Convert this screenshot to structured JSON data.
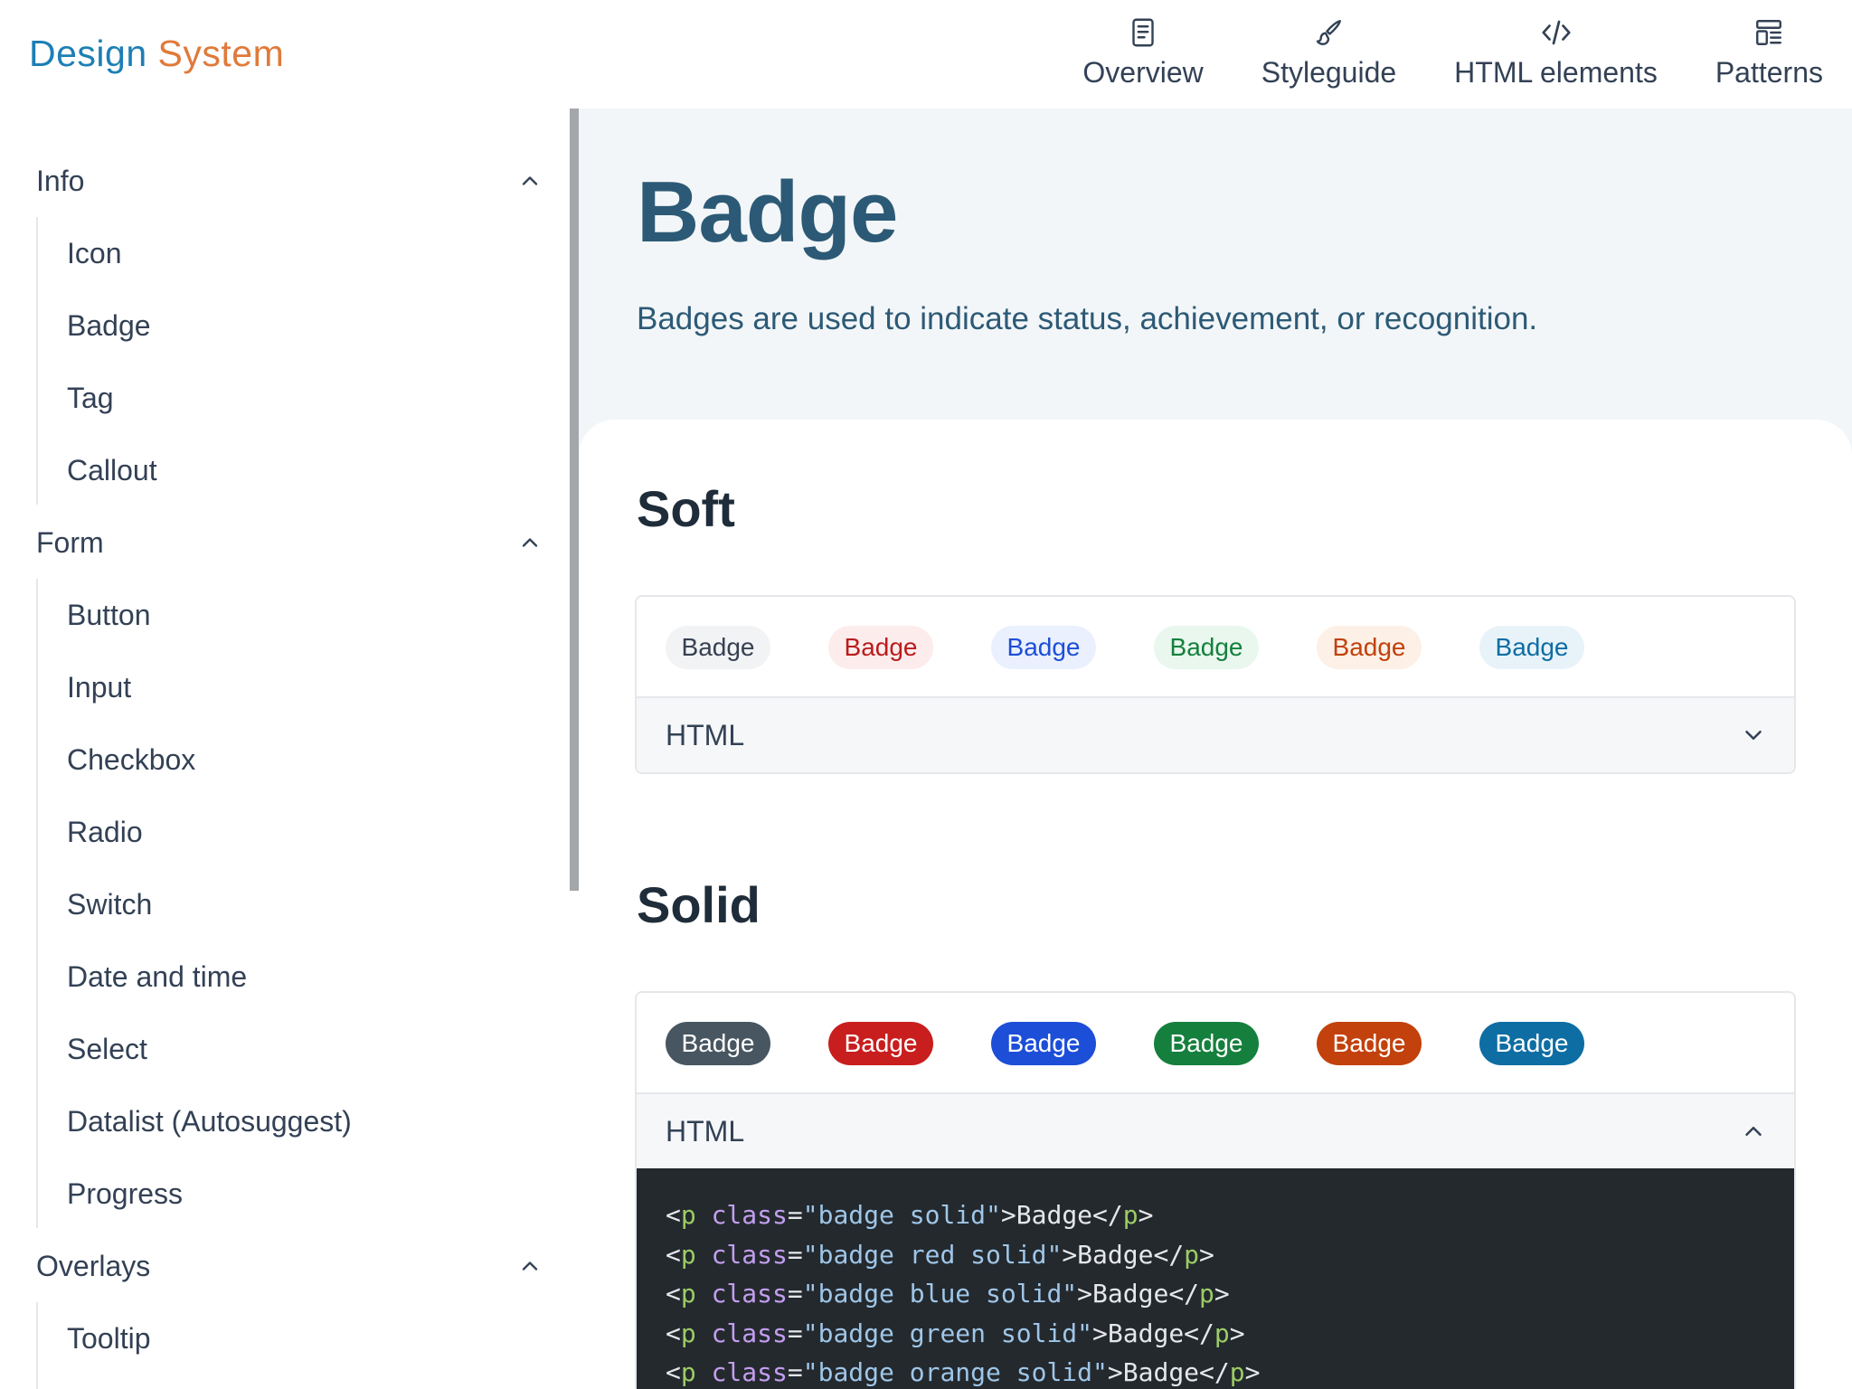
{
  "logo": {
    "word1": "Design",
    "word2": "System"
  },
  "topnav": [
    {
      "label": "Overview",
      "icon": "document-icon"
    },
    {
      "label": "Styleguide",
      "icon": "brush-icon"
    },
    {
      "label": "HTML elements",
      "icon": "code-icon"
    },
    {
      "label": "Patterns",
      "icon": "layout-icon"
    }
  ],
  "sidebar": {
    "groups": [
      {
        "label": "Info",
        "items": [
          "Icon",
          "Badge",
          "Tag",
          "Callout"
        ]
      },
      {
        "label": "Form",
        "items": [
          "Button",
          "Input",
          "Checkbox",
          "Radio",
          "Switch",
          "Date and time",
          "Select",
          "Datalist (Autosuggest)",
          "Progress"
        ]
      },
      {
        "label": "Overlays",
        "items": [
          "Tooltip"
        ]
      }
    ]
  },
  "page": {
    "title": "Badge",
    "description": "Badges are used to indicate status, achievement, or recognition."
  },
  "sections": {
    "soft": {
      "title": "Soft",
      "accordion_label": "HTML",
      "badges": [
        "Badge",
        "Badge",
        "Badge",
        "Badge",
        "Badge",
        "Badge"
      ]
    },
    "solid": {
      "title": "Solid",
      "accordion_label": "HTML",
      "badges": [
        "Badge",
        "Badge",
        "Badge",
        "Badge",
        "Badge",
        "Badge"
      ],
      "code_lines": [
        {
          "tag": "p",
          "attr": "class",
          "value": "\"badge solid\"",
          "text": "Badge"
        },
        {
          "tag": "p",
          "attr": "class",
          "value": "\"badge red solid\"",
          "text": "Badge"
        },
        {
          "tag": "p",
          "attr": "class",
          "value": "\"badge blue solid\"",
          "text": "Badge"
        },
        {
          "tag": "p",
          "attr": "class",
          "value": "\"badge green solid\"",
          "text": "Badge"
        },
        {
          "tag": "p",
          "attr": "class",
          "value": "\"badge orange solid\"",
          "text": "Badge"
        }
      ]
    }
  },
  "colors": {
    "soft": [
      {
        "bg": "#f1f3f5",
        "fg": "#374151"
      },
      {
        "bg": "#fdecec",
        "fg": "#b91c1c"
      },
      {
        "bg": "#eaf0fd",
        "fg": "#1d4ed8"
      },
      {
        "bg": "#e9f7ee",
        "fg": "#15803d"
      },
      {
        "bg": "#fdf0e6",
        "fg": "#c2410c"
      },
      {
        "bg": "#e8f3f9",
        "fg": "#0e6da3"
      }
    ],
    "solid": [
      {
        "bg": "#475660",
        "fg": "#ffffff"
      },
      {
        "bg": "#c81e1e",
        "fg": "#ffffff"
      },
      {
        "bg": "#1d4ed8",
        "fg": "#ffffff"
      },
      {
        "bg": "#15803d",
        "fg": "#ffffff"
      },
      {
        "bg": "#c2410c",
        "fg": "#ffffff"
      },
      {
        "bg": "#0e6da3",
        "fg": "#ffffff"
      }
    ]
  }
}
